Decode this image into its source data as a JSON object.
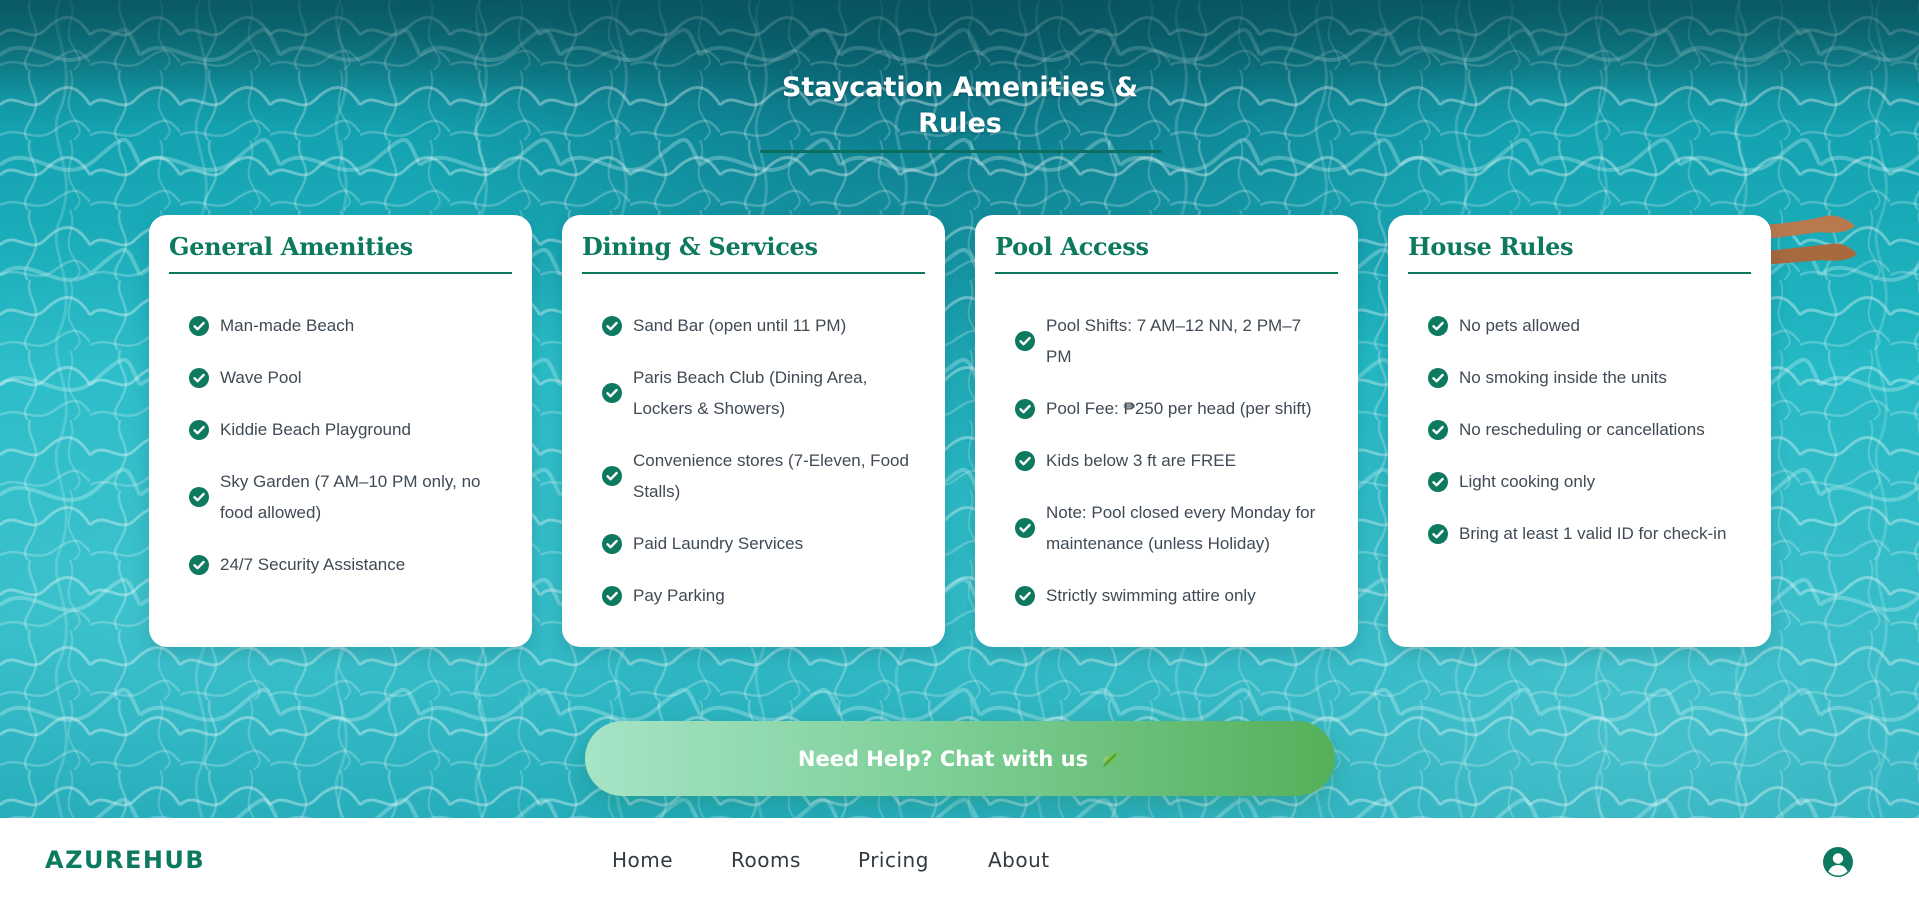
{
  "section": {
    "title": "Staycation Amenities & Rules"
  },
  "cards": [
    {
      "title": "General Amenities",
      "items": [
        "Man-made Beach",
        "Wave Pool",
        "Kiddie Beach Playground",
        "Sky Garden (7 AM–10 PM only, no food allowed)",
        "24/7 Security Assistance"
      ]
    },
    {
      "title": "Dining & Services",
      "items": [
        "Sand Bar (open until 11 PM)",
        "Paris Beach Club (Dining Area, Lockers & Showers)",
        "Convenience stores (7-Eleven, Food Stalls)",
        "Paid Laundry Services",
        "Pay Parking"
      ]
    },
    {
      "title": "Pool Access",
      "items": [
        "Pool Shifts: 7 AM–12 NN, 2 PM–7 PM",
        "Pool Fee: ₱250 per head (per shift)",
        "Kids below 3 ft are FREE",
        "Note: Pool closed every Monday for maintenance (unless Holiday)",
        "Strictly swimming attire only"
      ]
    },
    {
      "title": "House Rules",
      "items": [
        "No pets allowed",
        "No smoking inside the units",
        "No rescheduling or cancellations",
        "Light cooking only",
        "Bring at least 1 valid ID for check-in"
      ]
    }
  ],
  "help_button": {
    "label": "Need Help? Chat with us",
    "icon": "leaf-icon"
  },
  "navbar": {
    "brand": "AZUREHUB",
    "links": [
      "Home",
      "Rooms",
      "Pricing",
      "About"
    ],
    "profile_icon": "user-circle-icon"
  },
  "colors": {
    "accent": "#0d7a5f",
    "water": "#1fb0bd",
    "button_start": "#a6e4c6",
    "button_end": "#55b05a"
  }
}
